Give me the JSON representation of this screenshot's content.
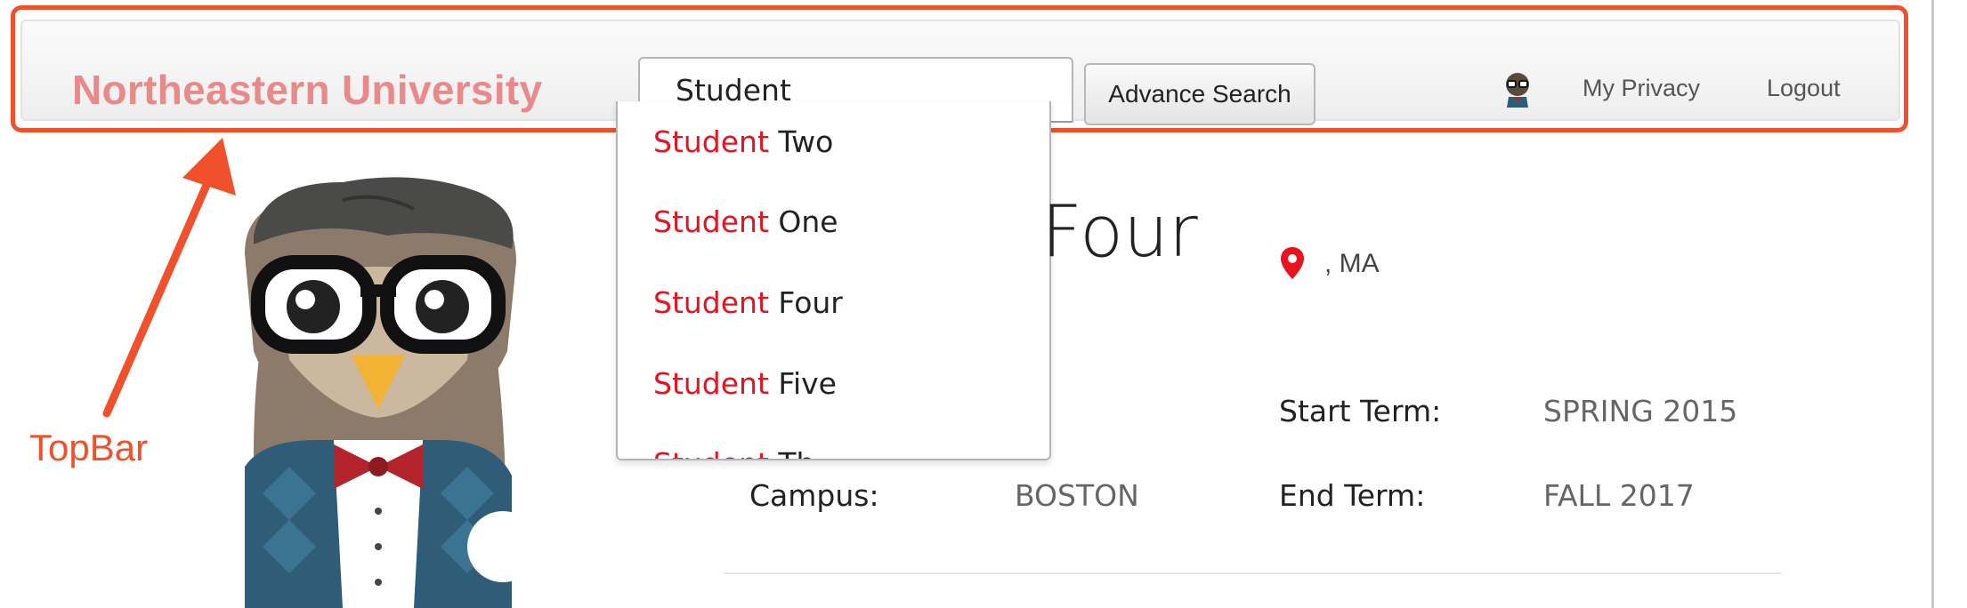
{
  "topbar": {
    "brand": "Northeastern University",
    "search_value": "Student",
    "advance_search_label": "Advance Search",
    "my_privacy_label": "My Privacy",
    "logout_label": "Logout"
  },
  "autocomplete": {
    "highlight": "Student",
    "items": [
      {
        "match": "Student",
        "rest": " Two"
      },
      {
        "match": "Student",
        "rest": " One"
      },
      {
        "match": "Student",
        "rest": " Four"
      },
      {
        "match": "Student",
        "rest": " Five"
      },
      {
        "match": "Student",
        "rest": " Th"
      }
    ]
  },
  "profile": {
    "name_visible": "Four",
    "location": ", MA",
    "campus_label": "Campus:",
    "campus_value": "BOSTON",
    "start_term_label": "Start Term:",
    "start_term_value": "SPRING 2015",
    "end_term_label": "End Term:",
    "end_term_value": "FALL 2017"
  },
  "annotation": {
    "label": "TopBar",
    "color": "#f0512b"
  },
  "colors": {
    "brand": "#e88a8a",
    "match_highlight": "#e8131e",
    "pin": "#e8131e"
  },
  "icons": [
    "owl-mascot-illustration",
    "avatar-icon",
    "location-pin-icon"
  ]
}
